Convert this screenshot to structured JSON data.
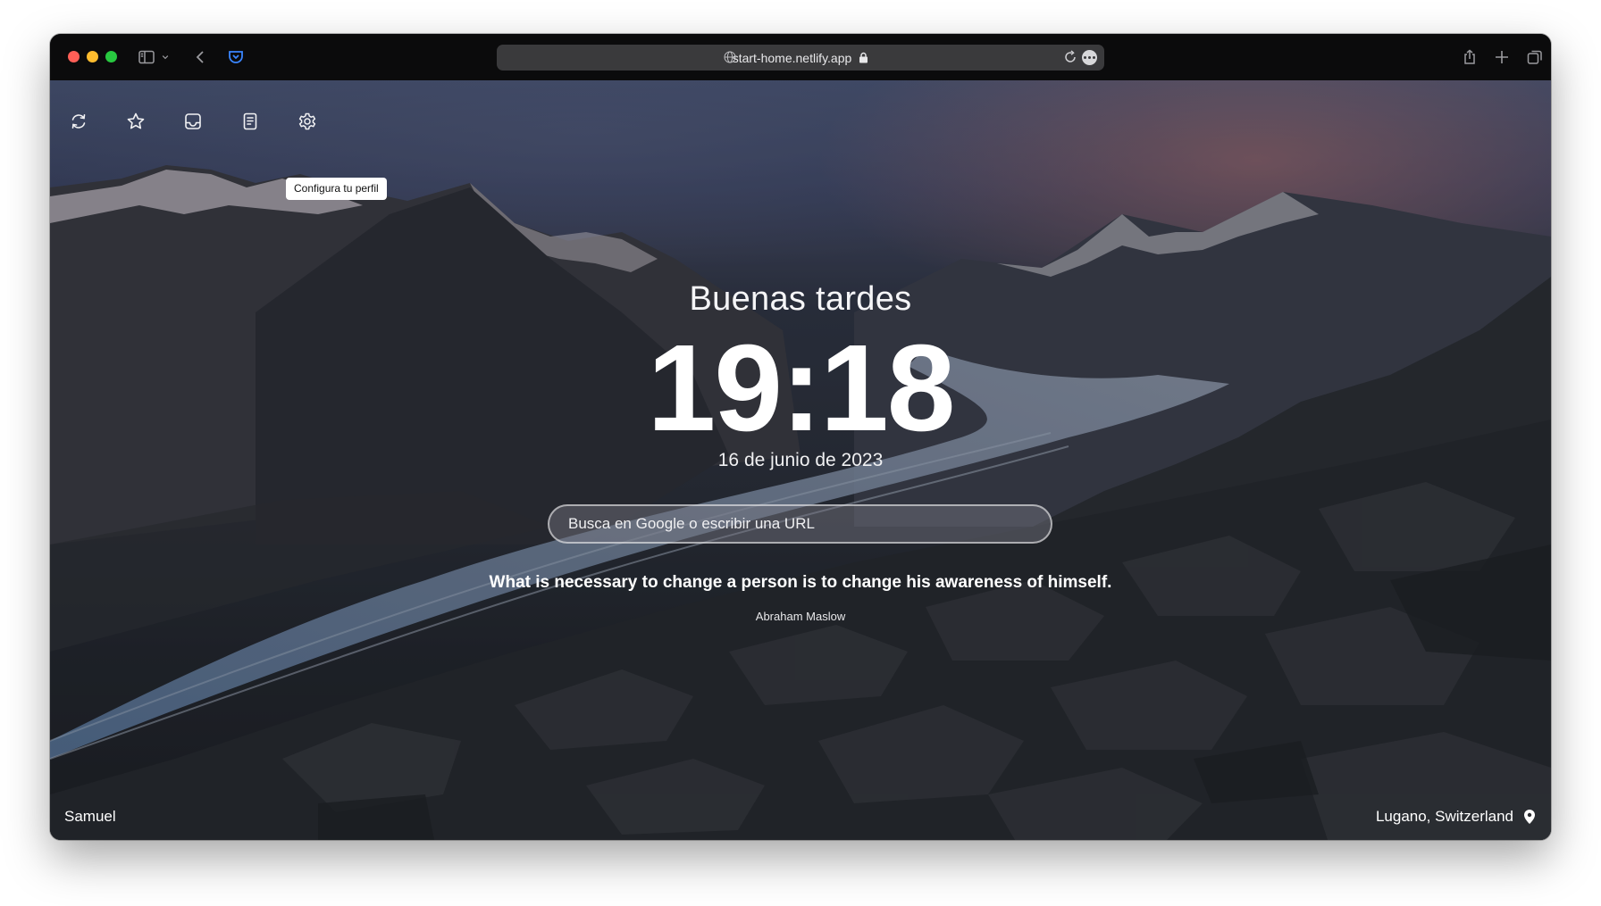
{
  "browser": {
    "url": "start-home.netlify.app",
    "traffic_colors": {
      "close": "#ff5f57",
      "minimize": "#febc2e",
      "zoom": "#28c840"
    }
  },
  "toolbar": {
    "tooltip": "Configura tu perfil"
  },
  "main": {
    "greeting": "Buenas tardes",
    "time": "19:18",
    "date": "16 de junio de 2023",
    "search_placeholder": "Busca en Google o escribir una URL",
    "quote": "What is necessary to change a person is to change his awareness of himself.",
    "author": "Abraham Maslow"
  },
  "footer": {
    "user": "Samuel",
    "location": "Lugano, Switzerland"
  }
}
